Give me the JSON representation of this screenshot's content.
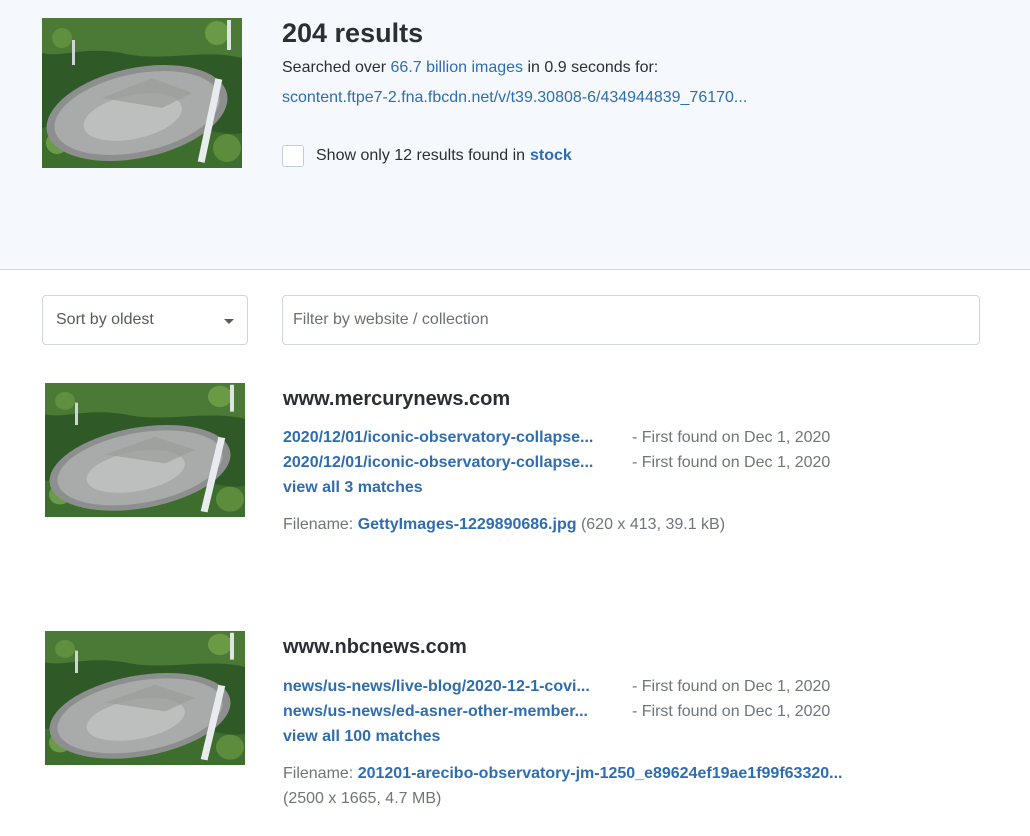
{
  "header": {
    "result_count": "204 results",
    "searched_prefix": "Searched over ",
    "searched_link": "66.7 billion images",
    "searched_suffix": " in 0.9 seconds for:",
    "query_url": "scontent.ftpe7-2.fna.fbcdn.net/v/t39.30808-6/434944839_76170...",
    "stock_prefix": "Show only 12 results found in",
    "stock_link": "stock"
  },
  "controls": {
    "sort_label": "Sort by oldest",
    "filter_placeholder": "Filter by website / collection"
  },
  "results": [
    {
      "site": "www.mercurynews.com",
      "matches": [
        {
          "path": "2020/12/01/iconic-observatory-collapse...",
          "found": "- First found on Dec 1, 2020"
        },
        {
          "path": "2020/12/01/iconic-observatory-collapse...",
          "found": "- First found on Dec 1, 2020"
        }
      ],
      "view_all": "view all 3 matches",
      "filename_label": "Filename:",
      "filename": "GettyImages-1229890686.jpg",
      "file_meta": "(620 x 413, 39.1 kB)"
    },
    {
      "site": "www.nbcnews.com",
      "matches": [
        {
          "path": "news/us-news/live-blog/2020-12-1-covi...",
          "found": "- First found on Dec 1, 2020"
        },
        {
          "path": "news/us-news/ed-asner-other-member...",
          "found": "- First found on Dec 1, 2020"
        }
      ],
      "view_all": "view all 100 matches",
      "filename_label": "Filename:",
      "filename": "201201-arecibo-observatory-jm-1250_e89624ef19ae1f99f63320...",
      "file_meta": "(2500 x 1665, 4.7 MB)"
    }
  ],
  "colors": {
    "link": "#2f6db0",
    "header_bg": "#f5f9fd"
  }
}
